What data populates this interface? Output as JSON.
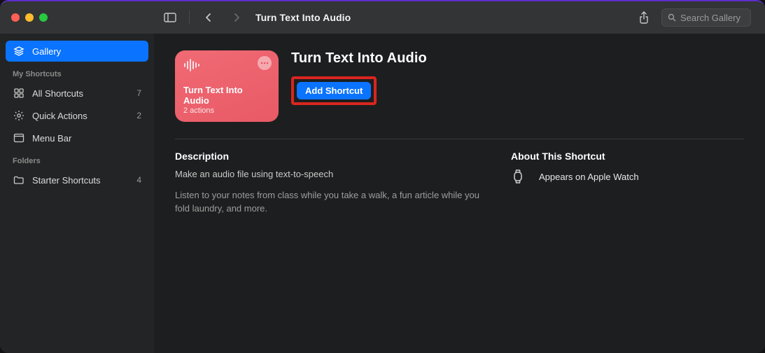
{
  "titlebar": {
    "title": "Turn Text Into Audio"
  },
  "search": {
    "placeholder": "Search Gallery"
  },
  "sidebar": {
    "gallery_label": "Gallery",
    "section_my": "My Shortcuts",
    "all_label": "All Shortcuts",
    "all_count": "7",
    "quick_label": "Quick Actions",
    "quick_count": "2",
    "menubar_label": "Menu Bar",
    "section_folders": "Folders",
    "starter_label": "Starter Shortcuts",
    "starter_count": "4"
  },
  "card": {
    "title": "Turn Text Into Audio",
    "subtitle": "2 actions"
  },
  "hero": {
    "title": "Turn Text Into Audio",
    "add_label": "Add Shortcut"
  },
  "desc": {
    "heading": "Description",
    "lead": "Make an audio file using text-to-speech",
    "body": "Listen to your notes from class while you take a walk, a fun article while you fold laundry, and more."
  },
  "about": {
    "heading": "About This Shortcut",
    "watch": "Appears on Apple Watch"
  }
}
